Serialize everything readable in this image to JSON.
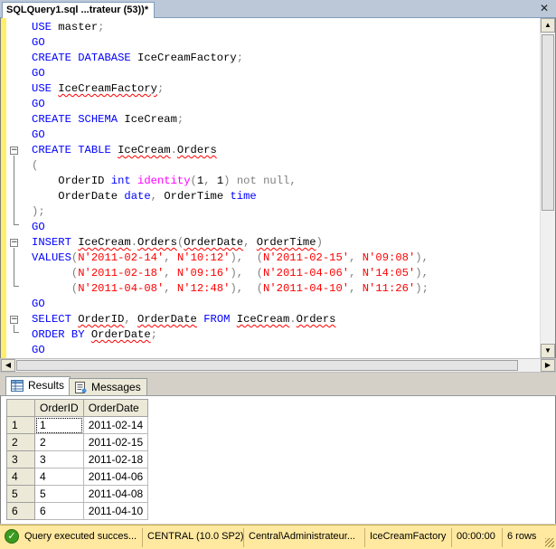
{
  "document_tab": {
    "title": "SQLQuery1.sql ...trateur (53))*"
  },
  "editor": {
    "lines": [
      [
        [
          "kw",
          "USE "
        ],
        [
          "ident",
          "master"
        ],
        [
          "dim",
          ";"
        ]
      ],
      [
        [
          "go",
          "GO"
        ]
      ],
      [
        [
          "kw",
          "CREATE DATABASE "
        ],
        [
          "ident",
          "IceCreamFactory"
        ],
        [
          "dim",
          ";"
        ]
      ],
      [
        [
          "go",
          "GO"
        ]
      ],
      [
        [
          "kw",
          "USE "
        ],
        [
          "sq",
          "IceCreamFactory"
        ],
        [
          "dim",
          ";"
        ]
      ],
      [
        [
          "go",
          "GO"
        ]
      ],
      [
        [
          "kw",
          "CREATE SCHEMA "
        ],
        [
          "ident",
          "IceCream"
        ],
        [
          "dim",
          ";"
        ]
      ],
      [
        [
          "go",
          "GO"
        ]
      ],
      [
        [
          "kw",
          "CREATE TABLE "
        ],
        [
          "sq",
          "IceCream"
        ],
        [
          "dim",
          "."
        ],
        [
          "sq",
          "Orders"
        ]
      ],
      [
        [
          "dim",
          "("
        ]
      ],
      [
        [
          "ident",
          "    OrderID "
        ],
        [
          "kw",
          "int "
        ],
        [
          "fn",
          "identity"
        ],
        [
          "dim",
          "("
        ],
        [
          "num",
          "1"
        ],
        [
          "dim",
          ", "
        ],
        [
          "num",
          "1"
        ],
        [
          "dim",
          ") "
        ],
        [
          "dim",
          "not null"
        ],
        [
          "dim",
          ","
        ]
      ],
      [
        [
          "ident",
          "    OrderDate "
        ],
        [
          "kw",
          "date"
        ],
        [
          "dim",
          ", "
        ],
        [
          "ident",
          "OrderTime "
        ],
        [
          "kw",
          "time"
        ]
      ],
      [
        [
          "dim",
          ");"
        ]
      ],
      [
        [
          "go",
          "GO"
        ]
      ],
      [
        [
          "kw",
          "INSERT "
        ],
        [
          "sq",
          "IceCream"
        ],
        [
          "dim",
          "."
        ],
        [
          "sq",
          "Orders"
        ],
        [
          "dim",
          "("
        ],
        [
          "sq",
          "OrderDate"
        ],
        [
          "dim",
          ", "
        ],
        [
          "sq",
          "OrderTime"
        ],
        [
          "dim",
          ")"
        ]
      ],
      [
        [
          "kw",
          "VALUES"
        ],
        [
          "dim",
          "("
        ],
        [
          "str",
          "N'2011-02-14'"
        ],
        [
          "dim",
          ", "
        ],
        [
          "str",
          "N'10:12'"
        ],
        [
          "dim",
          "),  ("
        ],
        [
          "str",
          "N'2011-02-15'"
        ],
        [
          "dim",
          ", "
        ],
        [
          "str",
          "N'09:08'"
        ],
        [
          "dim",
          "),"
        ]
      ],
      [
        [
          "dim",
          "      ("
        ],
        [
          "str",
          "N'2011-02-18'"
        ],
        [
          "dim",
          ", "
        ],
        [
          "str",
          "N'09:16'"
        ],
        [
          "dim",
          "),  ("
        ],
        [
          "str",
          "N'2011-04-06'"
        ],
        [
          "dim",
          ", "
        ],
        [
          "str",
          "N'14:05'"
        ],
        [
          "dim",
          "),"
        ]
      ],
      [
        [
          "dim",
          "      ("
        ],
        [
          "str",
          "N'2011-04-08'"
        ],
        [
          "dim",
          ", "
        ],
        [
          "str",
          "N'12:48'"
        ],
        [
          "dim",
          "),  ("
        ],
        [
          "str",
          "N'2011-04-10'"
        ],
        [
          "dim",
          ", "
        ],
        [
          "str",
          "N'11:26'"
        ],
        [
          "dim",
          ");"
        ]
      ],
      [
        [
          "go",
          "GO"
        ]
      ],
      [
        [
          "kw",
          "SELECT "
        ],
        [
          "sq",
          "OrderID"
        ],
        [
          "dim",
          ", "
        ],
        [
          "sq",
          "OrderDate"
        ],
        [
          "kw",
          " FROM "
        ],
        [
          "sq",
          "IceCream"
        ],
        [
          "dim",
          "."
        ],
        [
          "sq",
          "Orders"
        ]
      ],
      [
        [
          "kw",
          "ORDER BY "
        ],
        [
          "sq",
          "OrderDate"
        ],
        [
          "dim",
          ";"
        ]
      ],
      [
        [
          "go",
          "GO"
        ]
      ]
    ]
  },
  "results_tabs": [
    {
      "label": "Results",
      "active": true
    },
    {
      "label": "Messages",
      "active": false
    }
  ],
  "grid": {
    "columns": [
      "OrderID",
      "OrderDate"
    ],
    "rows": [
      [
        "1",
        "1",
        "2011-02-14"
      ],
      [
        "2",
        "2",
        "2011-02-15"
      ],
      [
        "3",
        "3",
        "2011-02-18"
      ],
      [
        "4",
        "4",
        "2011-04-06"
      ],
      [
        "5",
        "5",
        "2011-04-08"
      ],
      [
        "6",
        "6",
        "2011-04-10"
      ]
    ]
  },
  "statusbar": {
    "message": "Query executed succes...",
    "server": "CENTRAL (10.0 SP2)",
    "user": "Central\\Administrateur...",
    "database": "IceCreamFactory",
    "elapsed": "00:00:00",
    "rows": "6 rows"
  },
  "colors": {
    "keyword": "#0000ff",
    "string": "#ff0000",
    "function": "#ff00ff",
    "change_bar": "#ffef6a",
    "status_bar": "#ffe9a0"
  }
}
